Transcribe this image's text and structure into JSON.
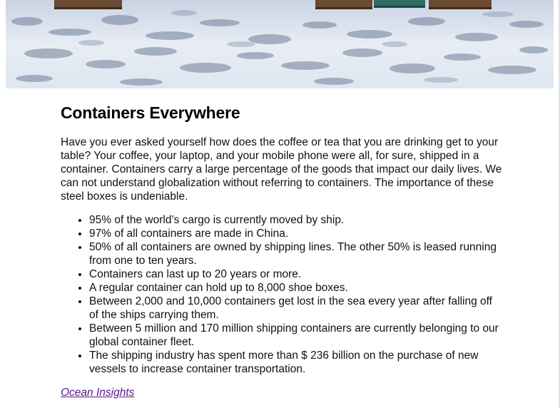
{
  "article": {
    "title": "Containers Everywhere",
    "intro": "Have you ever asked yourself how does the coffee or tea that you are drinking get to your table? Your coffee, your laptop, and your mobile phone were all, for sure, shipped in a container. Containers carry a large percentage of the goods that impact our daily lives. We can not understand globalization without referring to containers. The importance of these steel boxes is undeniable.",
    "facts": [
      "95% of the world’s cargo is currently moved by ship.",
      "97% of all containers are made in China.",
      "50% of all containers are owned by shipping lines. The other 50% is leased running from one to ten years.",
      "Containers can last up to 20 years or more.",
      "A regular container can hold up to 8,000 shoe boxes.",
      "Between 2,000 and 10,000 containers get lost in the sea every year after falling off of the ships carrying them.",
      "Between 5 million and 170 million shipping containers are currently belonging to our global container fleet.",
      "The shipping industry has spent more than $ 236 billion on the purchase of new vessels to increase container transportation."
    ],
    "source_link": "Ocean Insights"
  },
  "colors": {
    "link": "#551a8b",
    "sky_light": "#e9eef6",
    "sky_cloud": "#6f7f99",
    "container_brown": "#6b4a33",
    "container_teal": "#2f6d63"
  }
}
